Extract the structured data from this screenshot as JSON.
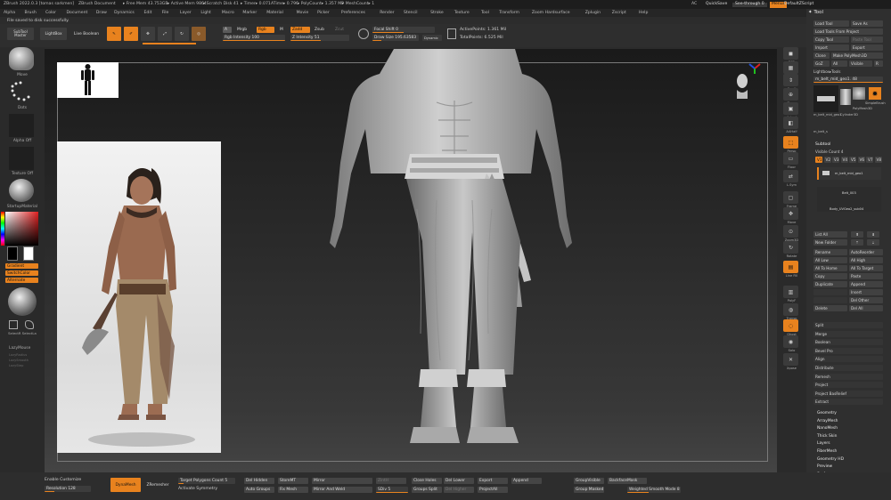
{
  "app": {
    "title": "ZBrush 2022.0.3 [tomas sarkmen]",
    "doc": "ZBrush Document",
    "stats": [
      "▸ Free Mem 43.753GB",
      "▸ Active Mem 9864",
      "▸ Scratch Disk 41",
      "▸ Timer▸ 0.071",
      "ATime▸ 0.796",
      "▸ PolyCount▸ 1.357 MP",
      "▸ MeshCount▸ 1"
    ],
    "ac": "AC",
    "quicksave": "QuickSave",
    "seethrough": "See-through",
    "seethrough_val": "0",
    "menus_btn": "Menus",
    "default_script": "DefaultZScript",
    "status": "File saved to disk successfully."
  },
  "menus": [
    "Alpha",
    "Brush",
    "Color",
    "Document",
    "Draw",
    "Dynamics",
    "Edit",
    "File",
    "Layer",
    "Light",
    "Macro",
    "Marker",
    "Material",
    "Movie",
    "Picker",
    "Preferences",
    "Render",
    "Stencil",
    "Stroke",
    "Texture",
    "Tool",
    "Transform",
    "Zoom Hardsurface",
    "Zplugin",
    "Zscript",
    "Help"
  ],
  "shelf": {
    "subtool_master": "SubTool Master",
    "lightbox": "LightBox",
    "live_boolean": "Live Boolean",
    "modes": [
      "Edit",
      "Draw",
      "Move",
      "Scale",
      "Rotate"
    ],
    "a_label": "A",
    "mrgb": "Mrgb",
    "rgb": "Rgb",
    "m": "M",
    "zadd": "Zadd",
    "zsub": "Zsub",
    "zcut": "Zcut",
    "rgb_intensity": "Rgb Intensity 100",
    "z_intensity": "Z Intensity 51",
    "focal_shift": "Focal Shift 0",
    "draw_size": "Draw Size 195.63583",
    "dynamic": "Dynamic",
    "active_points": "ActivePoints: 1.361 Mil",
    "total_points": "TotalPoints: 6.525 Mil"
  },
  "left": {
    "move": "Move",
    "dots": "Dots",
    "alpha_off": "Alpha Off",
    "texture_off": "Texture Off",
    "material": "StartupMaterial",
    "gradient": "Gradient",
    "switch_color": "SwitchColor",
    "alternate": "Alternate",
    "selectrect": "SelectR SelectLa",
    "lazymouse": "LazyMouse",
    "lazy_items": [
      "LazyRadius",
      "LazySmooth",
      "LazyStep"
    ]
  },
  "right_tray": [
    "BPR",
    "SPix 3",
    "Scroll",
    "Zoom",
    "Actual",
    "AAHalf",
    "Persp",
    "Floor",
    "L.Sym",
    "Frame",
    "Move",
    "Zoom3D",
    "Rotate",
    "Line Fill",
    "PolyF",
    "Transp",
    "Ghost",
    "Solo",
    "Xpose"
  ],
  "tool": {
    "header": "Tool",
    "load_tool": "Load Tool",
    "save_as": "Save As",
    "load_from_project": "Load Tools From Project",
    "copy_tool": "Copy Tool",
    "paste_tool": "Paste Tool",
    "import": "Import",
    "export": "Export",
    "clone": "Clone",
    "make_polymesh": "Make PolyMesh3D",
    "goz": "GoZ",
    "all": "All",
    "visible": "Visible",
    "r": "R",
    "lightbox_tools": "Lightbox▸Tools",
    "current": "m_belt_mid_geo1. 48",
    "thumbs": [
      "m_belt_mid_geo1",
      "Cylinder3D",
      "SimpleBrush",
      "PolyMesh3D",
      "m_belt_s"
    ],
    "subtool": "Subtool",
    "visible_count": "Visible Count 4",
    "versions": [
      "V1",
      "V2",
      "V3",
      "V4",
      "V5",
      "V6",
      "V7",
      "V8"
    ],
    "subtools": [
      "m_belt_mid_geo1",
      "Belt_003",
      "Body_UVGeo2_sub04"
    ],
    "list_all": "List All",
    "new_folder": "New Folder",
    "rows": [
      [
        "Rename",
        "AutoReorder"
      ],
      [
        "All Low",
        "All High"
      ],
      [
        "All To Home",
        "All To Target"
      ],
      [
        "Copy",
        "Paste"
      ],
      [
        "Duplicate",
        "Append"
      ],
      [
        "",
        "Insert"
      ],
      [
        "",
        "Del Other"
      ],
      [
        "Delete",
        "Del All"
      ]
    ],
    "single": [
      "Split",
      "Merge",
      "Boolean",
      "Bevel Pro",
      "Align",
      "Distribute",
      "Remesh",
      "Project",
      "Project BasRelief",
      "Extract"
    ],
    "sections": [
      "Geometry",
      "ArrayMesh",
      "NanoMesh",
      "Thick Skin",
      "Layers",
      "FiberMesh",
      "Geometry HD",
      "Preview",
      "Surface",
      "Deformation",
      "Masking"
    ]
  },
  "bottom": {
    "enable_customize": "Enable Customize",
    "resolution": "Resolution 128",
    "dynamesh": "DynaMesh",
    "zremesher": "ZRemesher",
    "target_poly": "Target Polygons Count 5",
    "activate_symmetry": "Activate Symmetry",
    "del_hidden": "Del Hidden",
    "storemt": "StoreMT",
    "mirror": "Mirror",
    "zintensity": "ZintH",
    "close_holes": "Close Holes",
    "del_lower": "Del Lower",
    "export": "Export",
    "append": "Append",
    "auto_groups": "Auto Groups",
    "fix_mesh": "Fix Mesh",
    "mirror_weld": "Mirror And Weld",
    "sdiv": "SDiv 5",
    "groups_split": "Groups Split",
    "del_higher": "Del Higher",
    "project_all": "ProjectAll",
    "group_visible": "GroupVisible",
    "backface_mask": "BackfaceMask",
    "group_masked": "Group Masked",
    "weighted_smooth": "Weighted Smooth Mode 8"
  },
  "colors": {
    "accent": "#e8821e",
    "bg": "#2c2c2c"
  }
}
